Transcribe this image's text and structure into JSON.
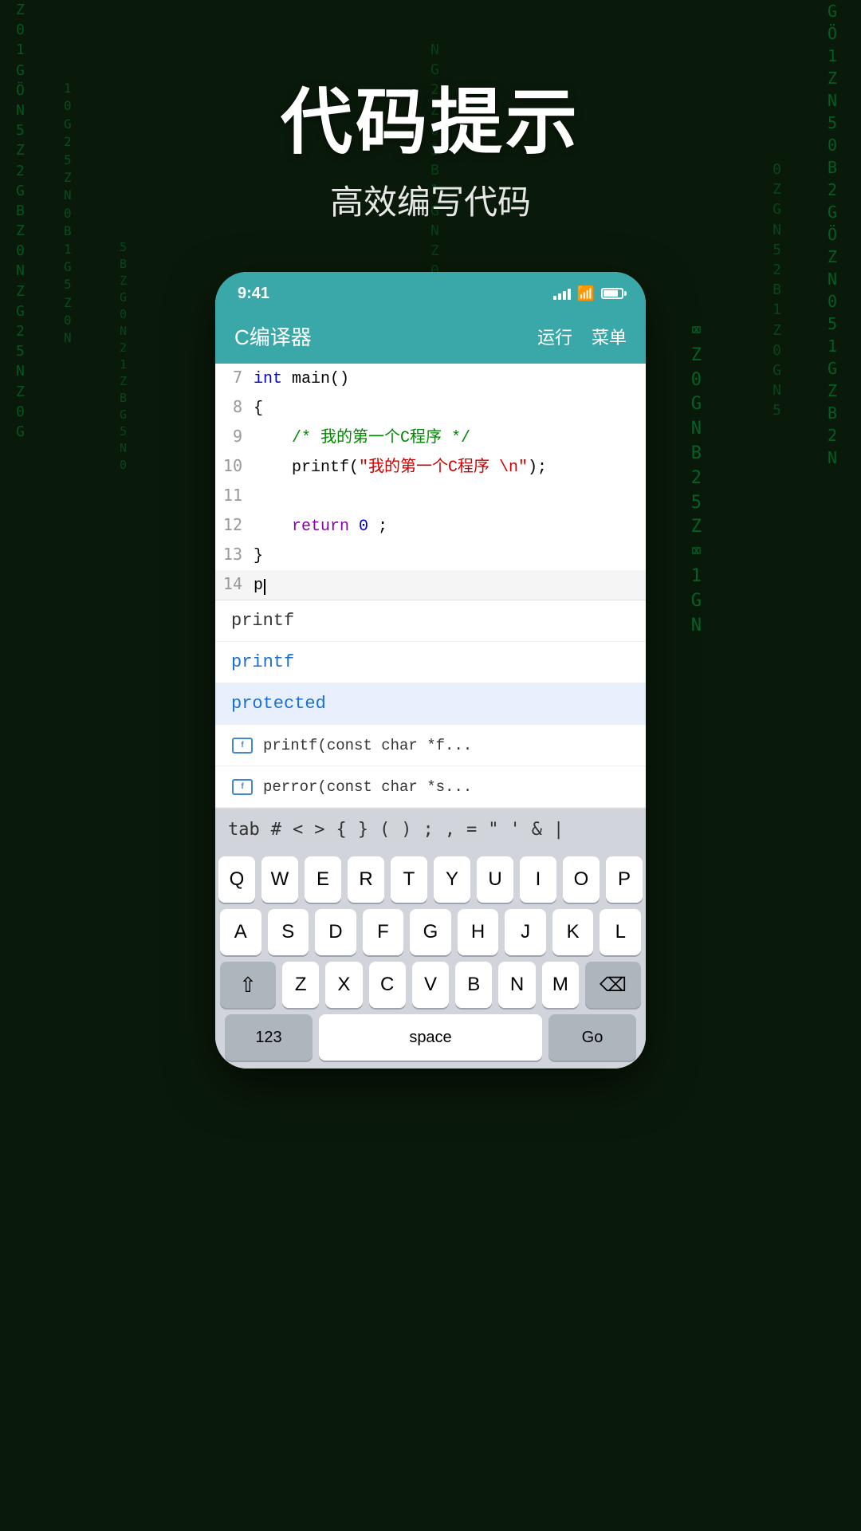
{
  "header": {
    "main_title": "代码提示",
    "sub_title": "高效编写代码"
  },
  "status_bar": {
    "time": "9:41"
  },
  "app_header": {
    "title": "C编译器",
    "run_btn": "运行",
    "menu_btn": "菜单"
  },
  "code_lines": [
    {
      "number": "7",
      "content": "int main()"
    },
    {
      "number": "8",
      "content": "{"
    },
    {
      "number": "9",
      "content": "    /* 我的第一个C程序 */"
    },
    {
      "number": "10",
      "content": "    printf(\"我的第一个C程序 \\n\");"
    },
    {
      "number": "11",
      "content": ""
    },
    {
      "number": "12",
      "content": "    return 0;"
    },
    {
      "number": "13",
      "content": "}"
    },
    {
      "number": "14",
      "content": "p"
    }
  ],
  "autocomplete": {
    "items": [
      {
        "type": "keyword",
        "text": "printf",
        "color": "black"
      },
      {
        "type": "keyword",
        "text": "printf",
        "color": "blue"
      },
      {
        "type": "keyword",
        "text": "protected",
        "color": "blue",
        "highlighted": true
      },
      {
        "type": "function",
        "text": "printf(const char *f...",
        "color": "black"
      },
      {
        "type": "function",
        "text": "perror(const char *s...",
        "color": "black"
      }
    ]
  },
  "shortcut_bar": {
    "keys": [
      "tab",
      "#",
      "<",
      ">",
      "{",
      "}",
      "(",
      ")",
      ";",
      ",",
      "=",
      "\"",
      "'",
      "&",
      "|"
    ]
  },
  "keyboard": {
    "row1": [
      "Q",
      "W",
      "E",
      "R",
      "T",
      "Y",
      "U",
      "I",
      "O",
      "P"
    ],
    "row2": [
      "A",
      "S",
      "D",
      "F",
      "G",
      "H",
      "J",
      "K",
      "L"
    ],
    "row3": [
      "Z",
      "X",
      "C",
      "V",
      "B",
      "N",
      "M"
    ],
    "bottom": {
      "nums": "123",
      "space": "space",
      "go": "Go"
    }
  }
}
